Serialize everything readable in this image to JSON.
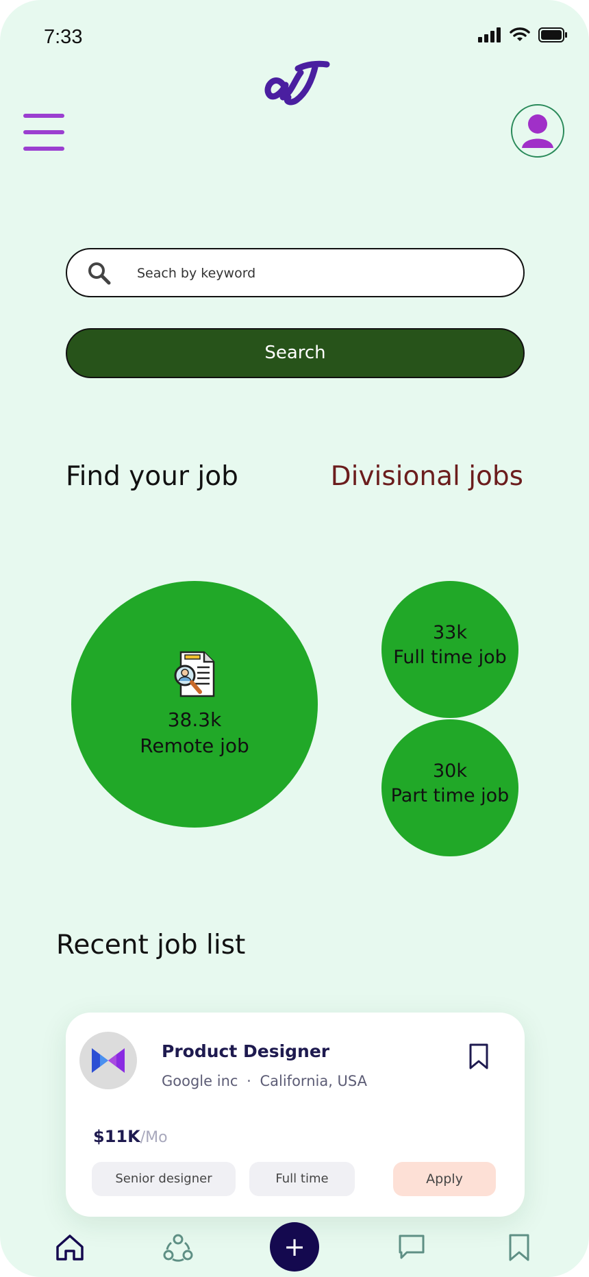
{
  "status_bar": {
    "time": "7:33"
  },
  "header": {
    "logo_icon": "aj-logo-icon",
    "menu_icon": "hamburger-menu-icon",
    "profile_icon": "user-avatar-icon"
  },
  "search": {
    "placeholder": "Seach by keyword",
    "value": "",
    "button_label": "Search"
  },
  "sections": {
    "find_title": "Find your job",
    "divisional_link": "Divisional jobs",
    "recent_title": "Recent job list"
  },
  "job_stats": [
    {
      "count": "38.3k",
      "label": "Remote job"
    },
    {
      "count": "33k",
      "label": "Full time job"
    },
    {
      "count": "30k",
      "label": "Part time job"
    }
  ],
  "recent_jobs": [
    {
      "title": "Product Designer",
      "company": "Google inc",
      "location": "California, USA",
      "salary": "$11K",
      "salary_period": "/Mo",
      "tags": [
        "Senior designer",
        "Full time"
      ],
      "apply_label": "Apply"
    }
  ],
  "bottom_nav": [
    "home-icon",
    "network-icon",
    "add-icon",
    "chat-icon",
    "bookmark-icon"
  ],
  "colors": {
    "background": "#e7f9ef",
    "bubble_green": "#21a828",
    "search_button": "#27531a",
    "accent_purple": "#9b3fd0",
    "divisional_red": "#6b1d1d",
    "nav_add": "#14094f"
  }
}
